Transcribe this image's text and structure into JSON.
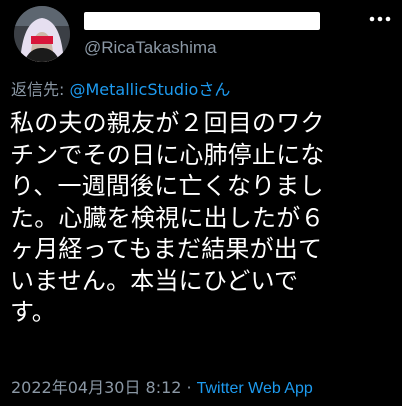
{
  "tweet": {
    "handle": "@RicaTakashima",
    "reply_prefix": "返信先: ",
    "reply_to": "@MetallicStudio",
    "reply_suffix": "さん",
    "body_lines": [
      "私の夫の親友が２回目のワク",
      "チンでその日に心肺停止にな",
      "り、一週間後に亡くなりまし",
      "た。心臓を検視に出したが６",
      "ヶ月経ってもまだ結果が出て",
      "いません。本当にひどいで",
      "す。"
    ],
    "timestamp": "2022年04月30日 8:12",
    "separator": "·",
    "source": "Twitter Web App"
  },
  "icons": {
    "avatar": "avatar-photo",
    "more": "more-options-icon"
  },
  "colors": {
    "background": "#000000",
    "text": "#ffffff",
    "secondary": "#8b98a5",
    "link": "#1d9bf0"
  }
}
